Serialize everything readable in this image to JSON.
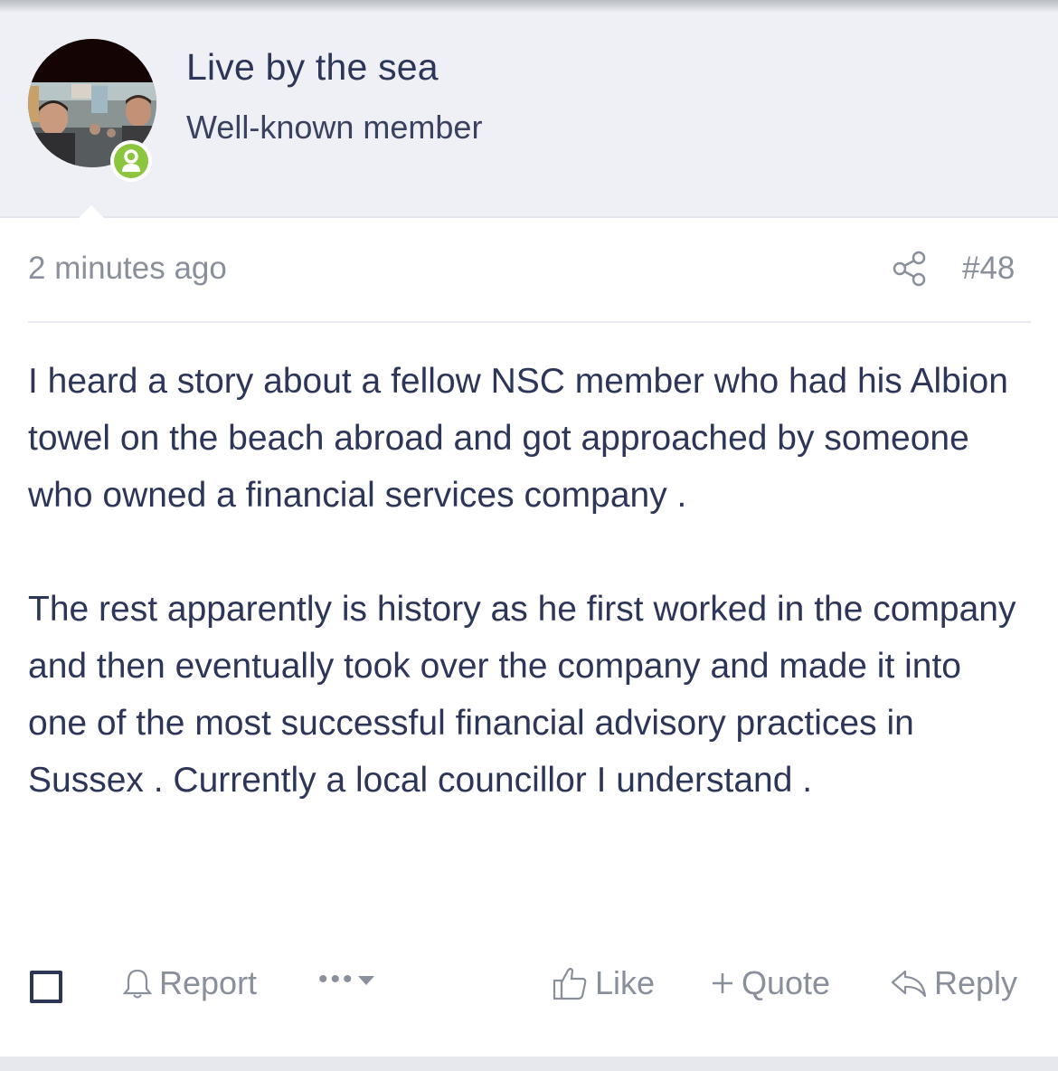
{
  "user": {
    "name": "Live by the sea",
    "title": "Well-known member",
    "online": true
  },
  "post": {
    "time": "2 minutes ago",
    "number": "#48",
    "paragraphs": [
      "I heard a story about a fellow NSC member who had his Albion towel on the beach abroad and got approached by someone who owned a financial services company .",
      "The rest apparently is history as he first worked in the company and then eventually took over the company and made it into one of the most successful financial advisory practices in Sussex . Currently a local councillor I understand ."
    ]
  },
  "actions": {
    "report": "Report",
    "like": "Like",
    "quote": "Quote",
    "reply": "Reply"
  },
  "colors": {
    "text": "#2d3658",
    "muted": "#8a8f9c",
    "header_bg": "#eef0f6",
    "online": "#8cc63f"
  }
}
